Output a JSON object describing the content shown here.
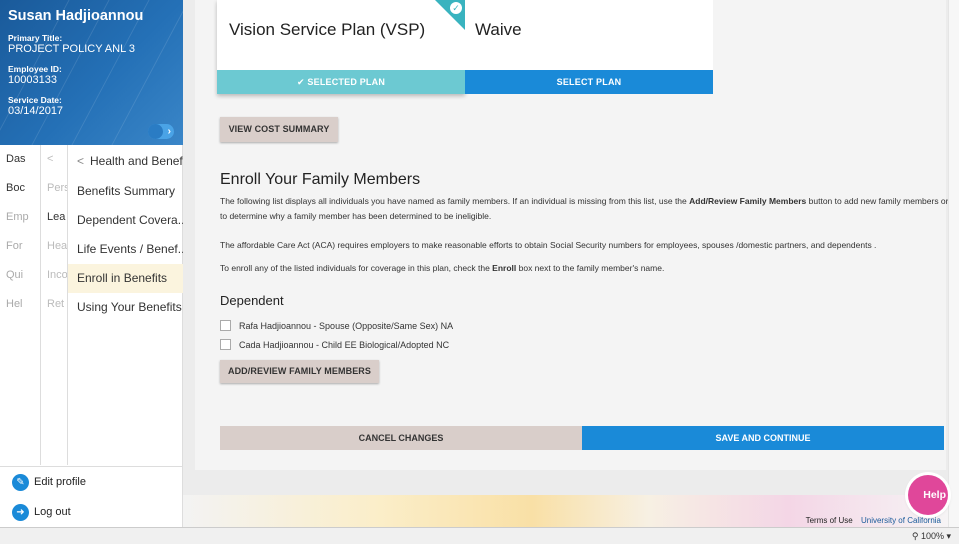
{
  "profile": {
    "name": "Susan Hadjioannou",
    "primary_title_label": "Primary Title:",
    "primary_title": "PROJECT POLICY ANL 3",
    "employee_id_label": "Employee ID:",
    "employee_id": "10003133",
    "service_date_label": "Service Date:",
    "service_date": "03/14/2017"
  },
  "nav": {
    "col1": [
      "Das",
      "Boc",
      "Emp",
      "For",
      "Qui",
      "Hel"
    ],
    "col2": [
      "<",
      "Pers",
      "Lea",
      "Hea",
      "Inco",
      "Ret"
    ],
    "header_label": "Health and Benefits",
    "items": [
      {
        "label": "Benefits Summary"
      },
      {
        "label": "Dependent Covera..."
      },
      {
        "label": "Life Events / Benef..."
      },
      {
        "label": "Enroll in Benefits",
        "active": true
      },
      {
        "label": "Using Your Benefits"
      }
    ]
  },
  "sidebar_bottom": {
    "edit_profile": "Edit profile",
    "log_out": "Log out"
  },
  "plans": {
    "vsp_title": "Vision Service Plan (VSP)",
    "vsp_button": "SELECTED PLAN",
    "waive_title": "Waive",
    "waive_button": "SELECT PLAN"
  },
  "view_cost_summary": "VIEW COST SUMMARY",
  "enroll": {
    "heading": "Enroll Your Family Members",
    "p1_a": "The following list displays all individuals you have named as family members. If an individual is missing from this list, use the ",
    "p1_bold": "Add/Review Family Members",
    "p1_b": " button to add new family members or to determine why a family member has been determined to be ineligible.",
    "p2": "The affordable Care Act (ACA) requires employers to make reasonable efforts to obtain Social Security numbers for employees, spouses /domestic partners, and dependents .",
    "p3_a": "To enroll any of the listed individuals for coverage in this plan, check the ",
    "p3_bold": "Enroll",
    "p3_b": " box next to the family member's name."
  },
  "dependent": {
    "heading": "Dependent",
    "members": [
      "Rafa Hadjioannou - Spouse (Opposite/Same Sex) NA",
      "Cada Hadjioannou - Child EE Biological/Adopted NC"
    ]
  },
  "add_review_button": "ADD/REVIEW FAMILY MEMBERS",
  "cancel_button": "CANCEL CHANGES",
  "save_button": "SAVE AND CONTINUE",
  "help_button": "Help",
  "footer": {
    "terms": "Terms of Use",
    "university": "University of California"
  },
  "status": {
    "zoom": "100%"
  },
  "colors": {
    "primary_blue": "#1a8ad8",
    "selected_teal": "#6cc9d2",
    "help_pink": "#e0479a"
  }
}
